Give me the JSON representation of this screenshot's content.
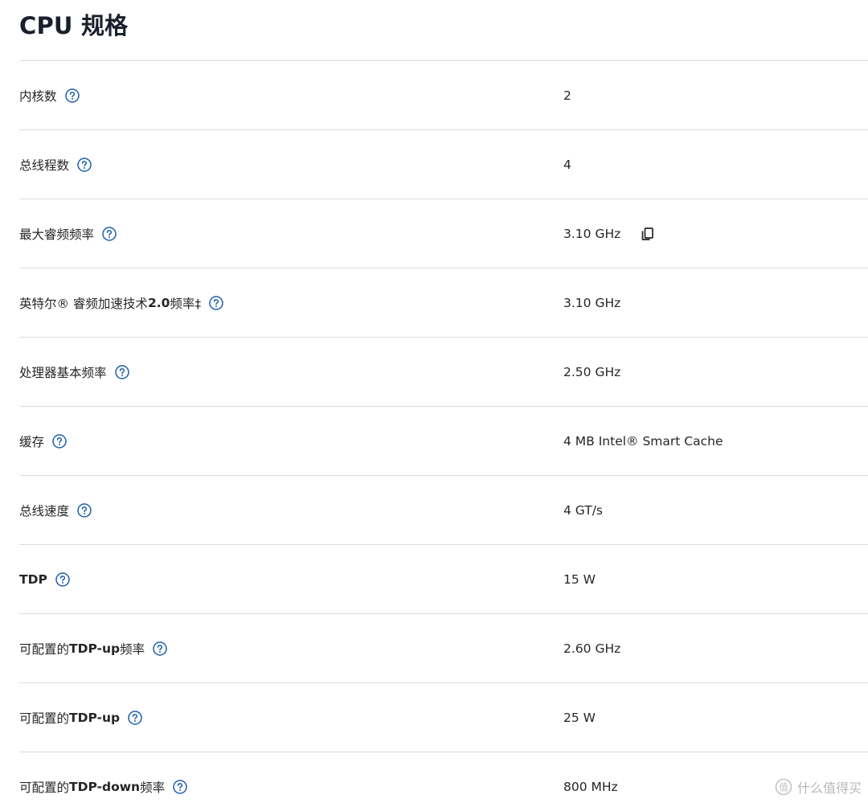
{
  "section": {
    "title": "CPU 规格"
  },
  "specs": [
    {
      "label_parts": [
        {
          "text": "内核数",
          "bold": false
        }
      ],
      "value": "2",
      "copy": false
    },
    {
      "label_parts": [
        {
          "text": "总线程数",
          "bold": false
        }
      ],
      "value": "4",
      "copy": false
    },
    {
      "label_parts": [
        {
          "text": "最大睿频频率",
          "bold": false
        }
      ],
      "value": "3.10 GHz",
      "copy": true
    },
    {
      "label_parts": [
        {
          "text": "英特尔® 睿频加速技术 ",
          "bold": false
        },
        {
          "text": "2.0",
          "bold": true
        },
        {
          "text": " 频率‡",
          "bold": false
        }
      ],
      "value": "3.10 GHz",
      "copy": false
    },
    {
      "label_parts": [
        {
          "text": "处理器基本频率",
          "bold": false
        }
      ],
      "value": "2.50 GHz",
      "copy": false
    },
    {
      "label_parts": [
        {
          "text": "缓存",
          "bold": false
        }
      ],
      "value": "4 MB Intel® Smart Cache",
      "copy": false
    },
    {
      "label_parts": [
        {
          "text": "总线速度",
          "bold": false
        }
      ],
      "value": "4 GT/s",
      "copy": false
    },
    {
      "label_parts": [
        {
          "text": "TDP",
          "bold": true
        }
      ],
      "value": "15 W",
      "copy": false
    },
    {
      "label_parts": [
        {
          "text": "可配置的 ",
          "bold": false
        },
        {
          "text": "TDP-up",
          "bold": true
        },
        {
          "text": " 频率",
          "bold": false
        }
      ],
      "value": "2.60 GHz",
      "copy": false
    },
    {
      "label_parts": [
        {
          "text": "可配置的 ",
          "bold": false
        },
        {
          "text": "TDP-up",
          "bold": true
        }
      ],
      "value": "25 W",
      "copy": false
    },
    {
      "label_parts": [
        {
          "text": "可配置的 ",
          "bold": false
        },
        {
          "text": "TDP-down",
          "bold": true
        },
        {
          "text": " 频率",
          "bold": false
        }
      ],
      "value": "800 MHz",
      "copy": false
    }
  ],
  "icons": {
    "help": "question-circle-icon",
    "copy": "copy-icon"
  },
  "colors": {
    "help_icon": "#1d5ea8",
    "divider": "#dcdcdc",
    "title": "#1a1f2c",
    "text": "#262626"
  },
  "watermark": {
    "text": "什么值得买"
  }
}
